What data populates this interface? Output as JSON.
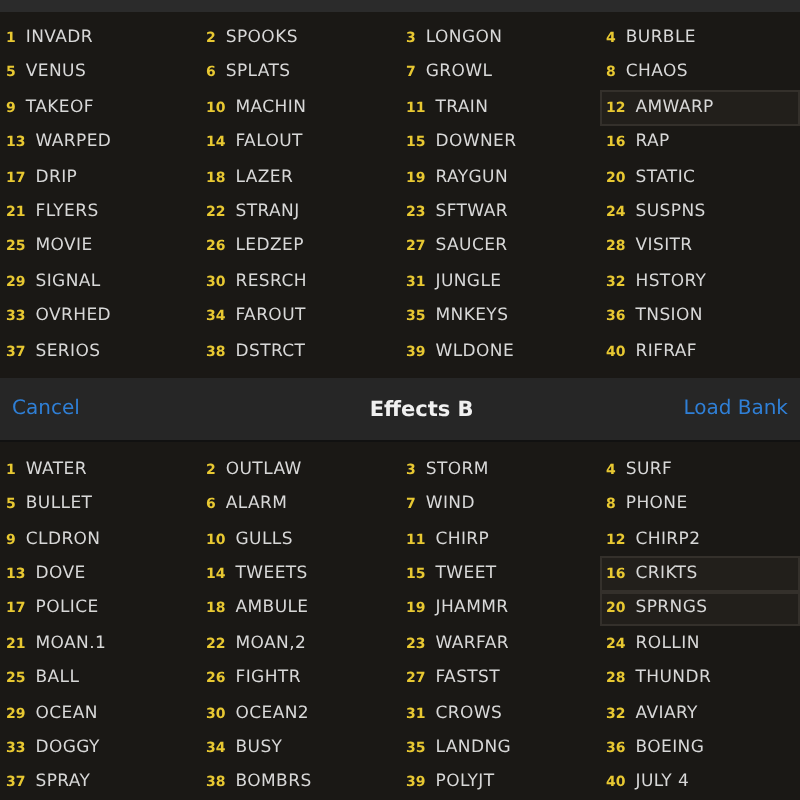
{
  "upper_bank": {
    "slots": [
      {
        "number": "1",
        "name": "INVADR",
        "selected": false
      },
      {
        "number": "2",
        "name": "SPOOKS",
        "selected": false
      },
      {
        "number": "3",
        "name": "LONGON",
        "selected": false
      },
      {
        "number": "4",
        "name": "BURBLE",
        "selected": false
      },
      {
        "number": "5",
        "name": "VENUS",
        "selected": false
      },
      {
        "number": "6",
        "name": "SPLATS",
        "selected": false
      },
      {
        "number": "7",
        "name": "GROWL",
        "selected": false
      },
      {
        "number": "8",
        "name": "CHAOS",
        "selected": false
      },
      {
        "number": "9",
        "name": "TAKEOF",
        "selected": false
      },
      {
        "number": "10",
        "name": "MACHIN",
        "selected": false
      },
      {
        "number": "11",
        "name": "TRAIN",
        "selected": false
      },
      {
        "number": "12",
        "name": "AMWARP",
        "selected": true
      },
      {
        "number": "13",
        "name": "WARPED",
        "selected": false
      },
      {
        "number": "14",
        "name": "FALOUT",
        "selected": false
      },
      {
        "number": "15",
        "name": "DOWNER",
        "selected": false
      },
      {
        "number": "16",
        "name": "RAP",
        "selected": false
      },
      {
        "number": "17",
        "name": "DRIP",
        "selected": false
      },
      {
        "number": "18",
        "name": "LAZER",
        "selected": false
      },
      {
        "number": "19",
        "name": "RAYGUN",
        "selected": false
      },
      {
        "number": "20",
        "name": "STATIC",
        "selected": false
      },
      {
        "number": "21",
        "name": "FLYERS",
        "selected": false
      },
      {
        "number": "22",
        "name": "STRANJ",
        "selected": false
      },
      {
        "number": "23",
        "name": "SFTWAR",
        "selected": false
      },
      {
        "number": "24",
        "name": "SUSPNS",
        "selected": false
      },
      {
        "number": "25",
        "name": "MOVIE",
        "selected": false
      },
      {
        "number": "26",
        "name": "LEDZEP",
        "selected": false
      },
      {
        "number": "27",
        "name": "SAUCER",
        "selected": false
      },
      {
        "number": "28",
        "name": "VISITR",
        "selected": false
      },
      {
        "number": "29",
        "name": "SIGNAL",
        "selected": false
      },
      {
        "number": "30",
        "name": "RESRCH",
        "selected": false
      },
      {
        "number": "31",
        "name": "JUNGLE",
        "selected": false
      },
      {
        "number": "32",
        "name": "HSTORY",
        "selected": false
      },
      {
        "number": "33",
        "name": "OVRHED",
        "selected": false
      },
      {
        "number": "34",
        "name": "FAROUT",
        "selected": false
      },
      {
        "number": "35",
        "name": "MNKEYS",
        "selected": false
      },
      {
        "number": "36",
        "name": "TNSION",
        "selected": false
      },
      {
        "number": "37",
        "name": "SERIOS",
        "selected": false
      },
      {
        "number": "38",
        "name": "DSTRCT",
        "selected": false
      },
      {
        "number": "39",
        "name": "WLDONE",
        "selected": false
      },
      {
        "number": "40",
        "name": "RIFRAF",
        "selected": false
      }
    ]
  },
  "dialog_bar": {
    "cancel": "Cancel",
    "title": "Effects B",
    "confirm": "Load Bank"
  },
  "lower_bank": {
    "slots": [
      {
        "number": "1",
        "name": "WATER",
        "selected": false
      },
      {
        "number": "2",
        "name": "OUTLAW",
        "selected": false
      },
      {
        "number": "3",
        "name": "STORM",
        "selected": false
      },
      {
        "number": "4",
        "name": "SURF",
        "selected": false
      },
      {
        "number": "5",
        "name": "BULLET",
        "selected": false
      },
      {
        "number": "6",
        "name": "ALARM",
        "selected": false
      },
      {
        "number": "7",
        "name": "WIND",
        "selected": false
      },
      {
        "number": "8",
        "name": "PHONE",
        "selected": false
      },
      {
        "number": "9",
        "name": "CLDRON",
        "selected": false
      },
      {
        "number": "10",
        "name": "GULLS",
        "selected": false
      },
      {
        "number": "11",
        "name": "CHIRP",
        "selected": false
      },
      {
        "number": "12",
        "name": "CHIRP2",
        "selected": false
      },
      {
        "number": "13",
        "name": "DOVE",
        "selected": false
      },
      {
        "number": "14",
        "name": "TWEETS",
        "selected": false
      },
      {
        "number": "15",
        "name": "TWEET",
        "selected": false
      },
      {
        "number": "16",
        "name": "CRIKTS",
        "selected": true
      },
      {
        "number": "17",
        "name": "POLICE",
        "selected": false
      },
      {
        "number": "18",
        "name": "AMBULE",
        "selected": false
      },
      {
        "number": "19",
        "name": "JHAMMR",
        "selected": false
      },
      {
        "number": "20",
        "name": "SPRNGS",
        "selected": true
      },
      {
        "number": "21",
        "name": "MOAN.1",
        "selected": false
      },
      {
        "number": "22",
        "name": "MOAN,2",
        "selected": false
      },
      {
        "number": "23",
        "name": "WARFAR",
        "selected": false
      },
      {
        "number": "24",
        "name": "ROLLIN",
        "selected": false
      },
      {
        "number": "25",
        "name": "BALL",
        "selected": false
      },
      {
        "number": "26",
        "name": "FIGHTR",
        "selected": false
      },
      {
        "number": "27",
        "name": "FASTST",
        "selected": false
      },
      {
        "number": "28",
        "name": "THUNDR",
        "selected": false
      },
      {
        "number": "29",
        "name": "OCEAN",
        "selected": false
      },
      {
        "number": "30",
        "name": "OCEAN2",
        "selected": false
      },
      {
        "number": "31",
        "name": "CROWS",
        "selected": false
      },
      {
        "number": "32",
        "name": "AVIARY",
        "selected": false
      },
      {
        "number": "33",
        "name": "DOGGY",
        "selected": false
      },
      {
        "number": "34",
        "name": "BUSY",
        "selected": false
      },
      {
        "number": "35",
        "name": "LANDNG",
        "selected": false
      },
      {
        "number": "36",
        "name": "BOEING",
        "selected": false
      },
      {
        "number": "37",
        "name": "SPRAY",
        "selected": false
      },
      {
        "number": "38",
        "name": "BOMBRS",
        "selected": false
      },
      {
        "number": "39",
        "name": "POLYJT",
        "selected": false
      },
      {
        "number": "40",
        "name": "JULY 4",
        "selected": false
      }
    ]
  }
}
